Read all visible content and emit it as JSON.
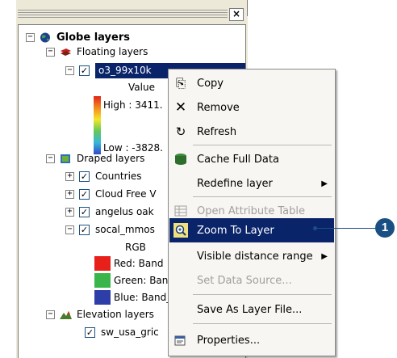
{
  "toc": {
    "root_label": "Globe layers",
    "floating_group": "Floating layers",
    "selected_layer": "o3_99x10k",
    "value_label": "Value",
    "high_label": "High : 3411.",
    "low_label": "Low : -3828.",
    "draped_group": "Draped layers",
    "draped_layers": [
      "Countries",
      "Cloud Free V",
      "angelus oak",
      "socal_mmos"
    ],
    "rgb_label": "RGB",
    "red_label": "Red:   Band",
    "green_label": "Green: Band",
    "blue_label": "Blue:   Band_",
    "elevation_group": "Elevation layers",
    "elevation_layer": "sw_usa_gric",
    "close_glyph": "×",
    "expand_minus": "−",
    "expand_plus": "+",
    "check_glyph": "✓"
  },
  "menu": {
    "copy": "Copy",
    "remove": "Remove",
    "refresh": "Refresh",
    "cache": "Cache Full Data",
    "redefine": "Redefine layer",
    "open_attr": "Open Attribute Table",
    "zoom": "Zoom To Layer",
    "visible_range": "Visible distance range",
    "set_source": "Set Data Source...",
    "save_layer": "Save As Layer File...",
    "properties": "Properties..."
  },
  "callout": {
    "number": "1"
  },
  "colors": {
    "selection": "#0a246a",
    "callout": "#1a4f83",
    "swatch_red": "#e8201a",
    "swatch_green": "#39b54a",
    "swatch_blue": "#2e3ea8"
  }
}
